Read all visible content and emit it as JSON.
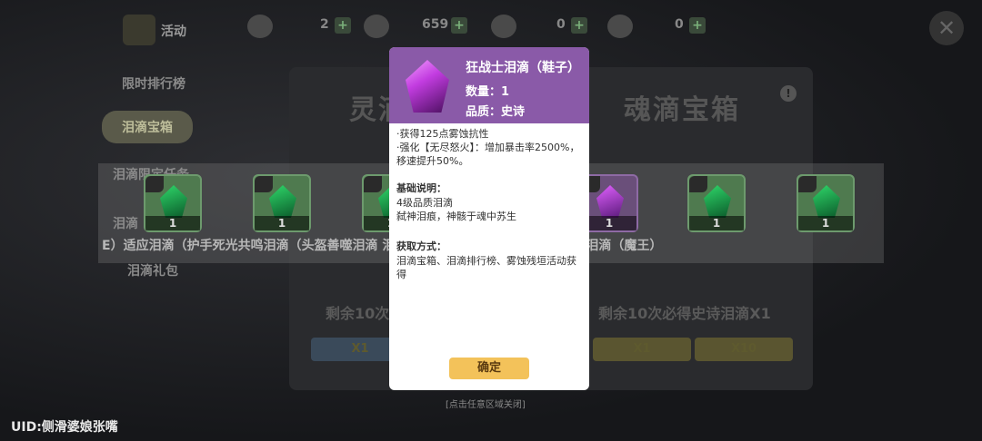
{
  "topbar": {
    "activity_label": "活动",
    "resources": [
      {
        "icon": "feather-icon",
        "value": "2"
      },
      {
        "icon": "coin-face-icon",
        "value": "659"
      },
      {
        "icon": "hammer-icon",
        "value": "0"
      },
      {
        "icon": "key-icon",
        "value": "0"
      }
    ],
    "plus": "+",
    "close_glyph": "✕"
  },
  "sidebar": {
    "items": [
      {
        "label": "限时排行榜"
      },
      {
        "label": "泪滴宝箱"
      },
      {
        "label": "泪滴限定任务"
      },
      {
        "label": "泪滴"
      },
      {
        "label": "泪滴礼包"
      }
    ]
  },
  "background": {
    "chest_left_title": "灵滴",
    "chest_right_title": "魂滴宝箱",
    "info_glyph": "!",
    "left_guarantee": "剩余10次",
    "right_guarantee": "剩余10次必得史诗泪滴X1",
    "buttons": [
      "X1",
      "X1",
      "X10"
    ]
  },
  "rewards": {
    "cards": [
      {
        "count": "1",
        "color": "green"
      },
      {
        "count": "1",
        "color": "green"
      },
      {
        "count": "1",
        "color": "green"
      },
      {
        "count": "1",
        "color": "purple"
      },
      {
        "count": "1",
        "color": "green"
      },
      {
        "count": "1",
        "color": "green"
      }
    ],
    "names_line": "E）适应泪滴（护手死光共鸣泪滴（头盔善噬泪滴             泪滴（鞋子）焚身泪滴（戒指）盟契泪滴（魔王）"
  },
  "modal": {
    "name": "狂战士泪滴（鞋子）",
    "quantity": "数量：1",
    "quality": "品质：史诗",
    "effect_1": "·获得125点雾蚀抗性",
    "effect_2": "·强化【无尽怒火】：增加暴击率2500%，移速提升50%。",
    "basic_title": "基础说明：",
    "basic_1": "4级品质泪滴",
    "basic_2": "弑神泪痕，神骸于魂中苏生",
    "source_title": "获取方式：",
    "source_text": "泪滴宝箱、泪滴排行榜、雾蚀残垣活动获得",
    "confirm": "确定"
  },
  "hint": "[点击任意区域关闭]",
  "uid": "UID:侧滑婆娘张嘴"
}
